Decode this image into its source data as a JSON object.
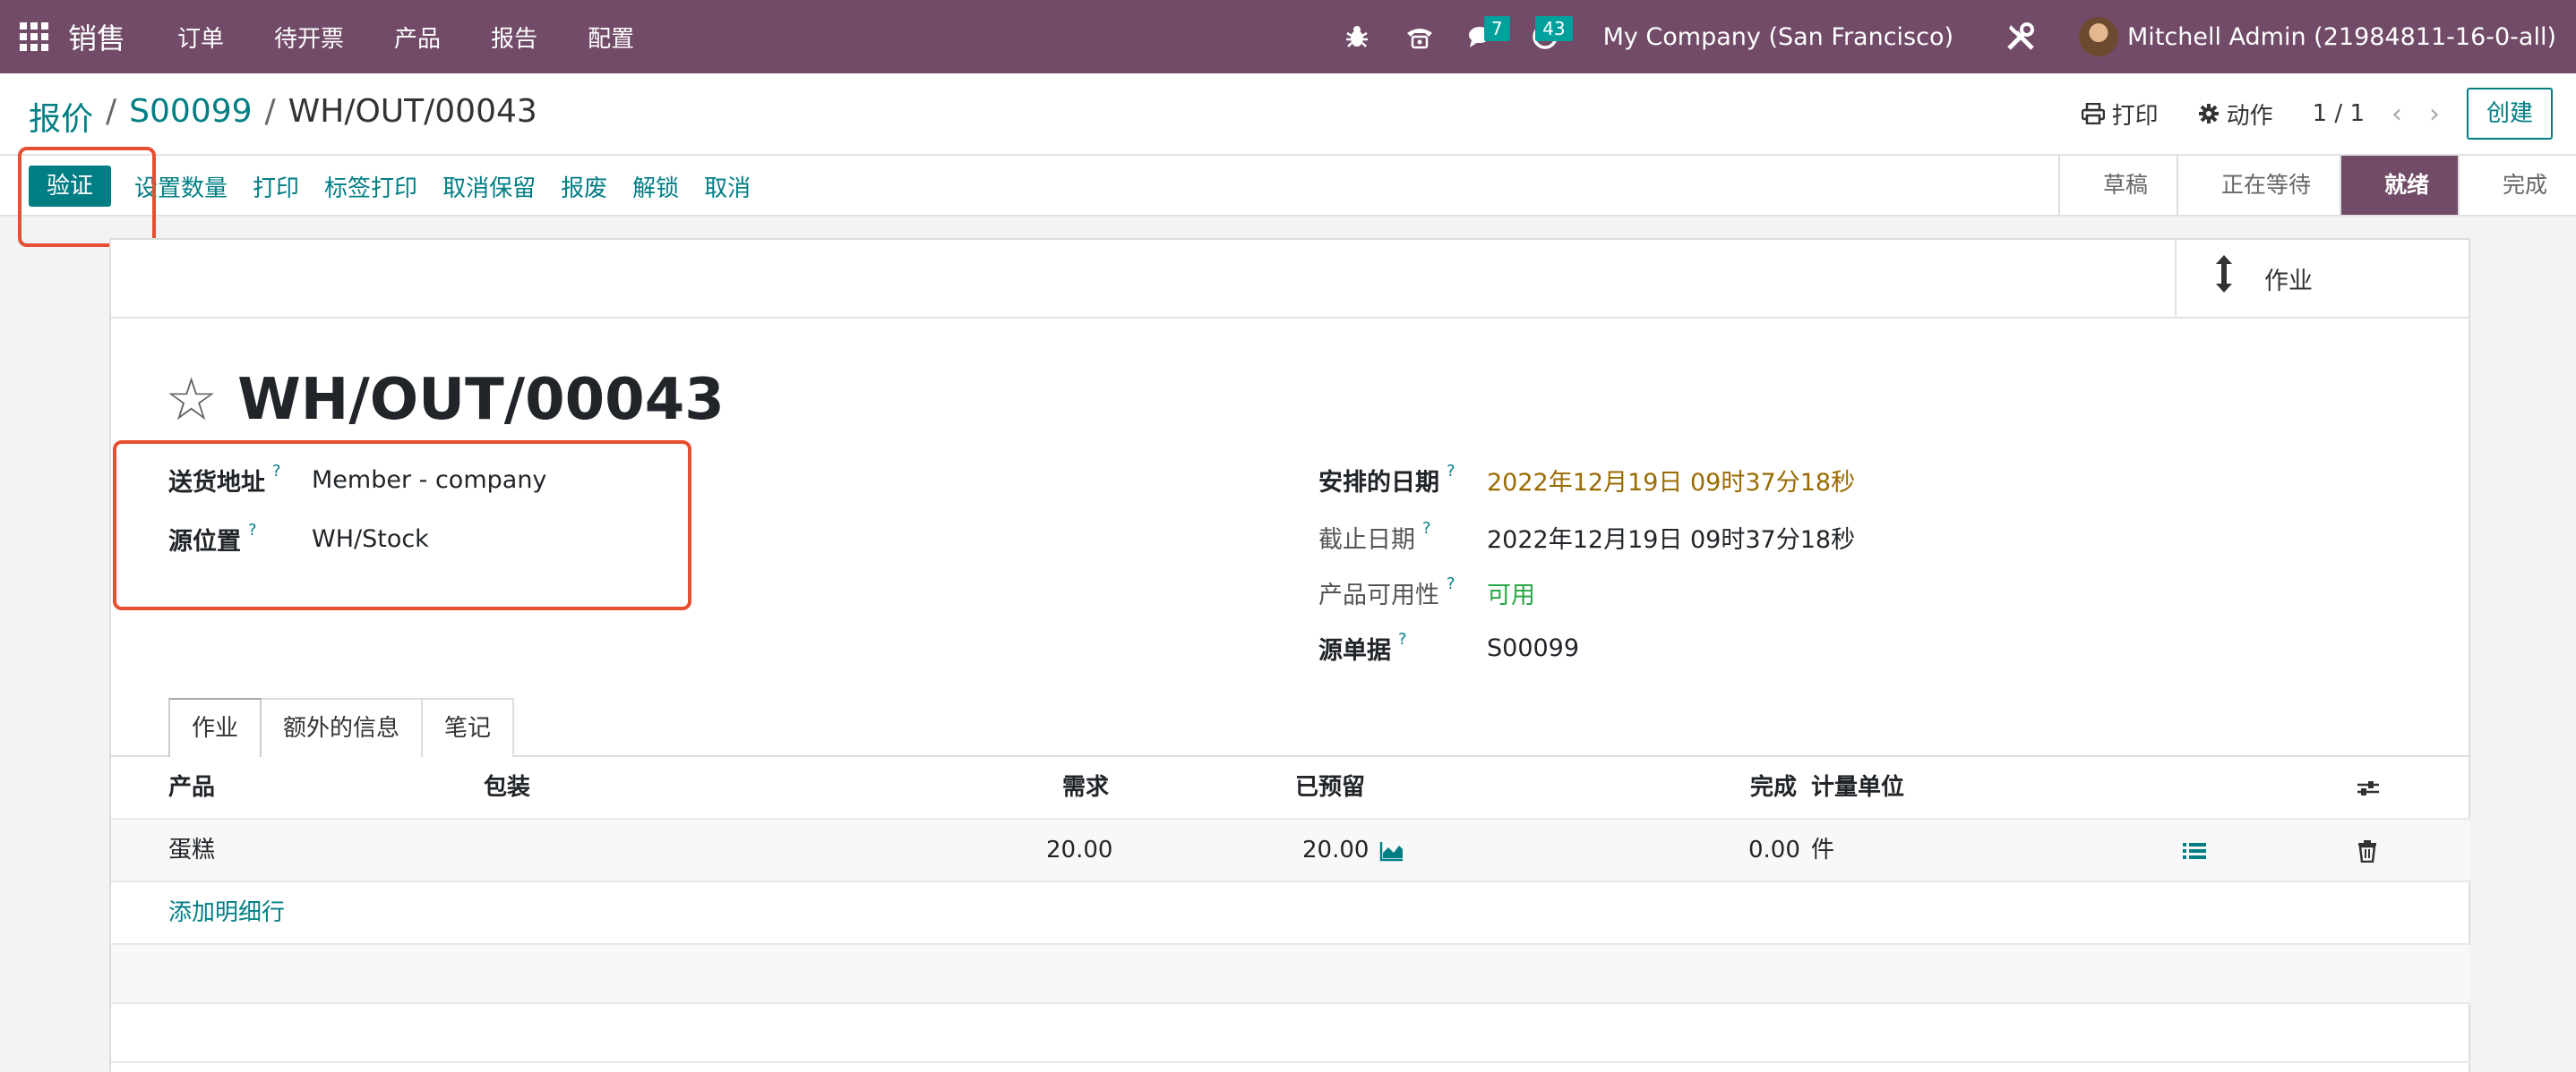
{
  "navbar": {
    "app_name": "销售",
    "menu": [
      "订单",
      "待开票",
      "产品",
      "报告",
      "配置"
    ],
    "messages_count": "7",
    "activities_count": "43",
    "company": "My Company (San Francisco)",
    "user": "Mitchell Admin (21984811-16-0-all)"
  },
  "breadcrumb": {
    "root": "报价",
    "parent": "S00099",
    "current": "WH/OUT/00043"
  },
  "control_panel": {
    "print_label": "打印",
    "action_label": "动作",
    "pager": "1 / 1",
    "create_label": "创建"
  },
  "action_bar": {
    "validate_label": "验证",
    "buttons": [
      "设置数量",
      "打印",
      "标签打印",
      "取消保留",
      "报废",
      "解锁",
      "取消"
    ],
    "stages": [
      "草稿",
      "正在等待",
      "就绪",
      "完成"
    ],
    "active_stage": "就绪"
  },
  "smart_button": {
    "label": "作业"
  },
  "record": {
    "title": "WH/OUT/00043",
    "fields_left": [
      {
        "label": "送货地址",
        "value": "Member - company"
      },
      {
        "label": "源位置",
        "value": "WH/Stock"
      }
    ],
    "scheduled_date": {
      "label": "安排的日期",
      "value": "2022年12月19日 09时37分18秒",
      "color": "#9a6b01"
    },
    "deadline": {
      "label": "截止日期",
      "value": "2022年12月19日 09时37分18秒"
    },
    "availability": {
      "label": "产品可用性",
      "value": "可用",
      "color": "#28a745"
    },
    "source_document": {
      "label": "源单据",
      "value": "S00099"
    },
    "help_mark": "?"
  },
  "tabs": [
    "作业",
    "额外的信息",
    "笔记"
  ],
  "table": {
    "headers": {
      "product": "产品",
      "package": "包装",
      "demand": "需求",
      "reserved": "已预留",
      "done": "完成",
      "uom": "计量单位"
    },
    "rows": [
      {
        "product": "蛋糕",
        "demand": "20.00",
        "reserved": "20.00",
        "done": "0.00",
        "uom": "件"
      }
    ],
    "add_line": "添加明细行"
  },
  "colors": {
    "navbar": "#714b67",
    "primary": "#017e84",
    "highlight": "#e54f32"
  }
}
